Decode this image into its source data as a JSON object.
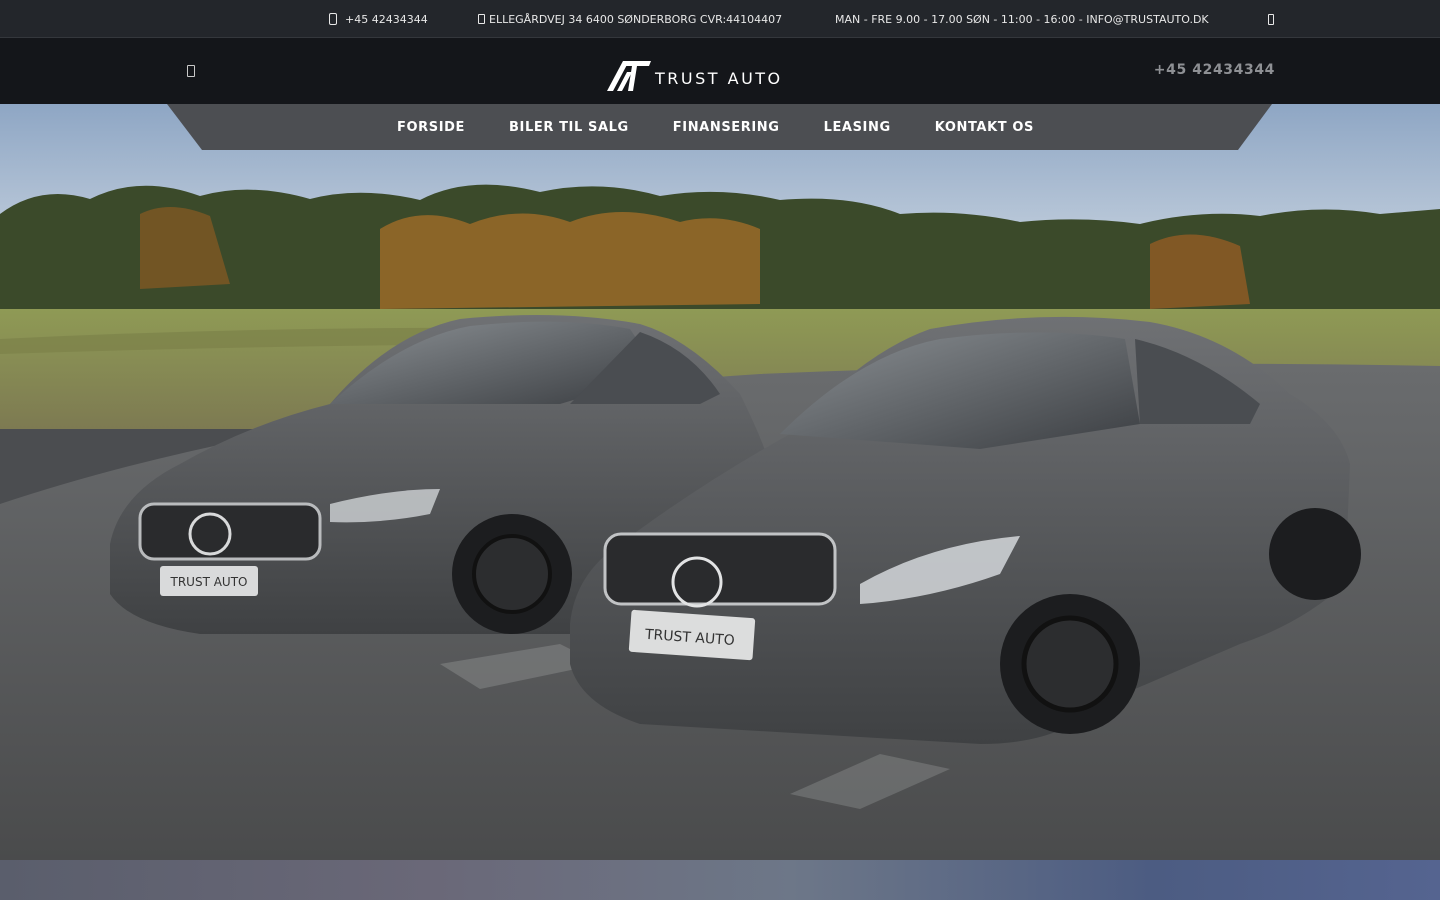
{
  "topbar": {
    "phone": "+45 42434344",
    "address": "ELLEGÅRDVEJ 34 6400 SØNDERBORG CVR:44104407",
    "hours": "MAN - FRE 9.00 - 17.00 SØN - 11:00 - 16:00 - INFO@TRUSTAUTO.DK",
    "phone_icon": "phone-icon",
    "address_icon": "map-pin-icon",
    "social_icon": "facebook-icon"
  },
  "header": {
    "logo_text": "TRUST AUTO",
    "phone": "+45 42434344",
    "menu_icon": "menu-icon"
  },
  "nav": {
    "items": [
      {
        "label": "FORSIDE"
      },
      {
        "label": "BILER TIL SALG"
      },
      {
        "label": "FINANSERING"
      },
      {
        "label": "LEASING"
      },
      {
        "label": "KONTAKT OS"
      }
    ]
  },
  "hero": {
    "plate_left": "TRUST AUTO",
    "plate_right": "TRUST AUTO"
  },
  "colors": {
    "topbar_bg": "#23262b",
    "header_bg": "#14161a",
    "nav_bg": "#4c4e52",
    "text": "#ffffff",
    "header_phone": "#8e9094"
  }
}
